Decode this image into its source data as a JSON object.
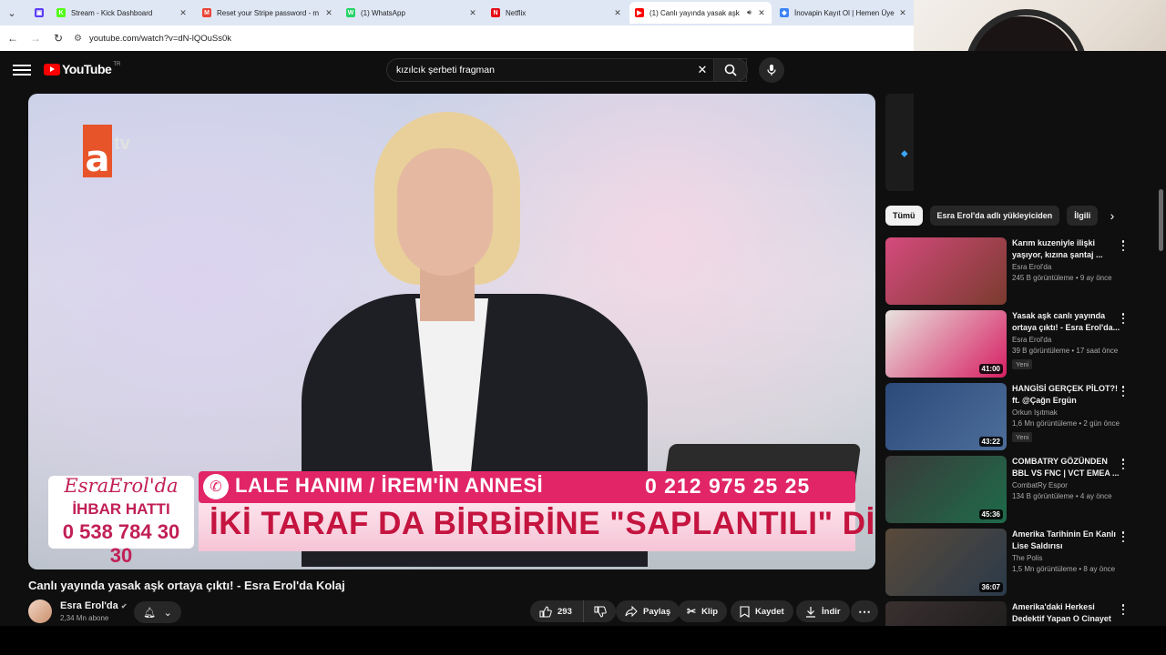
{
  "browser": {
    "tabs": [
      {
        "title": "Stream - Kick Dashboard",
        "fav": "K",
        "color": "#53fc18",
        "active": false
      },
      {
        "title": "Reset your Stripe password - m",
        "fav": "M",
        "color": "#ea4335",
        "active": false
      },
      {
        "title": "(1) WhatsApp",
        "fav": "W",
        "color": "#25d366",
        "active": false
      },
      {
        "title": "Netflix",
        "fav": "N",
        "color": "#e50914",
        "active": false
      },
      {
        "title": "(1) Canlı yayında yasak aşk",
        "fav": "▶",
        "color": "#ff0000",
        "active": true
      },
      {
        "title": "İnovapin Kayıt Ol | Hemen Üye",
        "fav": "◆",
        "color": "#3b82f6",
        "active": false
      }
    ],
    "url": "youtube.com/watch?v=dN-lQOuSs0k"
  },
  "youtube": {
    "logo_text": "YouTube",
    "country": "TR",
    "search_query": "kızılcık şerbeti fragman"
  },
  "player": {
    "channel_logo": "atv",
    "lower_third": {
      "show_name": "EsraErol'da",
      "hotline_label": "İHBAR HATTI",
      "hotline_number": "0 538 784 30 30",
      "caller": "LALE HANIM / İREM'İN ANNESİ",
      "studio_number": "0 212 975 25 25",
      "headline": "İKİ TARAF DA BİRBİRİNE \"SAPLANTILI\" DİYOR!"
    }
  },
  "video": {
    "title": "Canlı yayında yasak aşk ortaya çıktı! - Esra Erol'da Kolaj",
    "channel": "Esra Erol'da",
    "subscribers": "2,34 Mn abone",
    "likes": "293",
    "actions": {
      "share": "Paylaş",
      "clip": "Klip",
      "save": "Kaydet",
      "download": "İndir"
    }
  },
  "sidebar": {
    "chips": [
      "Tümü",
      "Esra Erol'da adlı yükleyiciden",
      "İlgili"
    ],
    "videos": [
      {
        "title": "Karım kuzeniyle ilişki yaşıyor, kızına şantaj ...",
        "channel": "Esra Erol'da",
        "meta": "245 B görüntüleme • 9 ay önce",
        "duration": "",
        "badge": "",
        "color1": "#d54a7d",
        "color2": "#7a3b2e"
      },
      {
        "title": "Yasak aşk canlı yayında ortaya çıktı! - Esra Erol'da...",
        "channel": "Esra Erol'da",
        "meta": "39 B görüntüleme • 17 saat önce",
        "duration": "41:00",
        "badge": "Yeni",
        "color1": "#e8e3df",
        "color2": "#d61f62"
      },
      {
        "title": "HANGİSİ GERÇEK PİLOT?! ft. @Çağn Ergün",
        "channel": "Orkun Işıtmak",
        "meta": "1,6 Mn görüntüleme • 2 gün önce",
        "duration": "43:22",
        "badge": "Yeni",
        "color1": "#2b4a7a",
        "color2": "#4d6d9a"
      },
      {
        "title": "COMBATRY GÖZÜNDEN BBL VS FNC | VCT EMEA ...",
        "channel": "CombatRy Espor",
        "meta": "134 B görüntüleme • 4 ay önce",
        "duration": "45:36",
        "badge": "",
        "color1": "#3a3a3a",
        "color2": "#1e6b4a"
      },
      {
        "title": "Amerika Tarihinin En Kanlı Lise Saldırısı",
        "channel": "The Polis",
        "meta": "1,5 Mn görüntüleme • 8 ay önce",
        "duration": "36:07",
        "badge": "",
        "color1": "#5a4a3a",
        "color2": "#2a3a4a"
      },
      {
        "title": "Amerika'daki Herkesi Dedektif Yapan O Cinayet",
        "channel": "",
        "meta": "",
        "duration": "",
        "badge": "",
        "color1": "#3a3030",
        "color2": "#1a1a1a"
      }
    ]
  }
}
